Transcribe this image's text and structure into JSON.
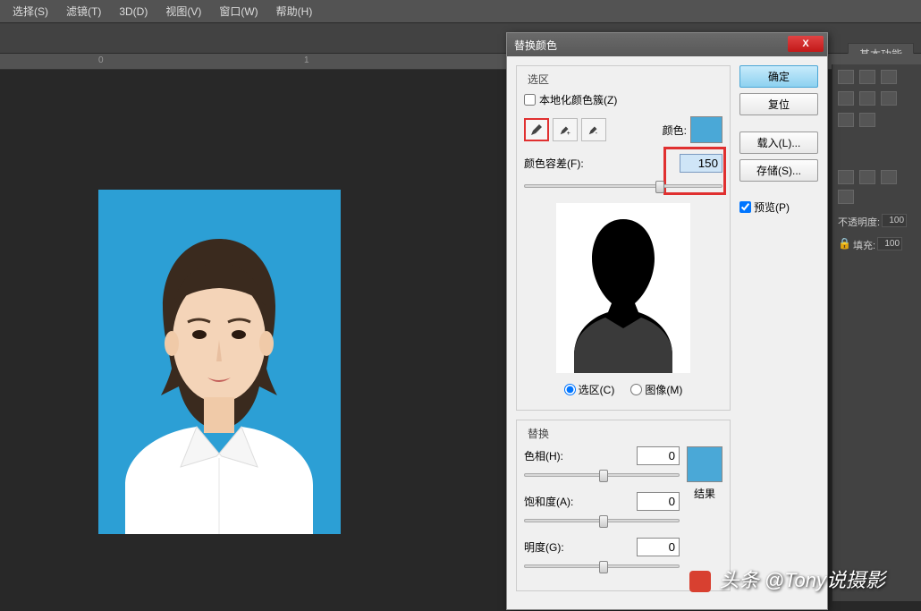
{
  "menu": {
    "items": [
      "选择(S)",
      "滤镜(T)",
      "3D(D)",
      "视图(V)",
      "窗口(W)",
      "帮助(H)"
    ]
  },
  "basic_func_label": "基本功能",
  "ruler": {
    "ticks": [
      {
        "pos": 110,
        "label": "0"
      },
      {
        "pos": 340,
        "label": "1"
      }
    ]
  },
  "dialog": {
    "title": "替换颜色",
    "close_symbol": "X",
    "buttons": {
      "ok": "确定",
      "cancel": "复位",
      "load": "载入(L)...",
      "save": "存储(S)..."
    },
    "preview_label": "预览(P)",
    "preview_checked": true,
    "selection": {
      "group_title": "选区",
      "localized_label": "本地化颜色簇(Z)",
      "localized_checked": false,
      "color_label": "颜色:",
      "swatch_color": "#4aa8d7",
      "fuzziness_label": "颜色容差(F):",
      "fuzziness_value": "150",
      "radio_selection": "选区(C)",
      "radio_image": "图像(M)",
      "radio_checked": "selection"
    },
    "replacement": {
      "group_title": "替换",
      "hue_label": "色相(H):",
      "hue_value": "0",
      "sat_label": "饱和度(A):",
      "sat_value": "0",
      "light_label": "明度(G):",
      "light_value": "0",
      "result_label": "结果",
      "result_color": "#4aa8d7"
    }
  },
  "right_panel": {
    "opacity_label": "不透明度:",
    "opacity_value": "100",
    "fill_label": "填充:",
    "fill_value": "100"
  },
  "watermark": "头条 @Tony说摄影",
  "colors": {
    "photo_bg": "#2c9fd5"
  }
}
